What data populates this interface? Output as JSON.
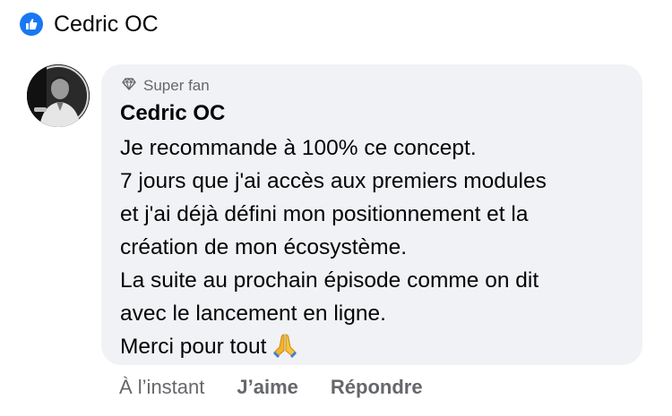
{
  "header": {
    "icon": "thumbs-up-icon",
    "name": "Cedric OC",
    "accent": "#1877f2"
  },
  "comment": {
    "avatar": "profile-photo",
    "badge": {
      "icon": "diamond-icon",
      "label": "Super fan"
    },
    "author": "Cedric OC",
    "lines": [
      "Je recommande à 100% ce concept.",
      "7 jours que j'ai accès aux premiers modules",
      "et j'ai déjà défini mon positionnement et la",
      "création de mon écosystème.",
      "La suite au prochain épisode comme on dit",
      "avec le lancement en ligne.",
      "Merci pour tout"
    ],
    "emoji": "folded-hands-icon"
  },
  "actions": {
    "time": "À l’instant",
    "like": "J’aime",
    "reply": "Répondre"
  }
}
